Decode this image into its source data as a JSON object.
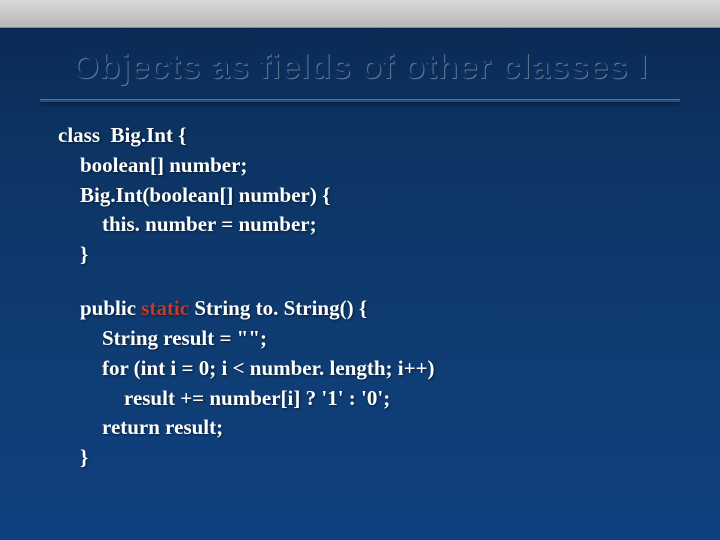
{
  "slide": {
    "title": "Objects as fields of other classes I",
    "code": {
      "l1": "class  Big.Int {",
      "l2": "boolean[] number;",
      "l3": "Big.Int(boolean[] number) {",
      "l4": "this. number = number;",
      "l5": "}",
      "l6a": "public ",
      "l6b": "static",
      "l6c": " String to. String() {",
      "l7": "String result = \"\";",
      "l8": "for (int i = 0; i < number. length; i++)",
      "l9": "result += number[i] ? '1' : '0';",
      "l10": "return result;",
      "l11": "}"
    }
  }
}
